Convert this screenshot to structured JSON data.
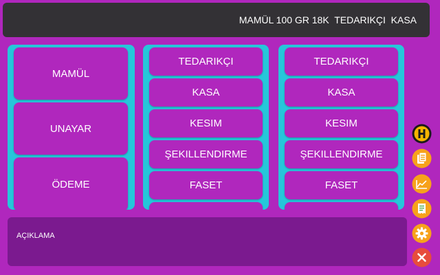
{
  "header": {
    "text": "MAMÜL 100 GR 18K  TEDARIKÇI  KASA"
  },
  "left_panel": {
    "items": [
      {
        "label": "MAMÜL"
      },
      {
        "label": "UNAYAR"
      },
      {
        "label": "ÖDEME"
      }
    ]
  },
  "middle_panel": {
    "items": [
      {
        "label": "TEDARIKÇI"
      },
      {
        "label": "KASA"
      },
      {
        "label": "KESIM"
      },
      {
        "label": "ŞEKILLENDIRME"
      },
      {
        "label": "FASET"
      },
      {
        "label": ""
      }
    ]
  },
  "right_panel": {
    "items": [
      {
        "label": "TEDARIKÇI"
      },
      {
        "label": "KASA"
      },
      {
        "label": "KESIM"
      },
      {
        "label": "ŞEKILLENDIRME"
      },
      {
        "label": "FASET"
      },
      {
        "label": ""
      }
    ]
  },
  "description": {
    "label": "AÇIKLAMA"
  },
  "side_toolbar": {
    "icons": [
      {
        "name": "h-logo-icon",
        "letter": "H",
        "color": "#f5b400"
      },
      {
        "name": "documents-icon",
        "color": "#f7a21b"
      },
      {
        "name": "chart-icon",
        "color": "#f7a21b"
      },
      {
        "name": "receipt-icon",
        "color": "#f7a21b"
      },
      {
        "name": "gear-icon",
        "color": "#f7a21b"
      },
      {
        "name": "close-icon",
        "color": "#e74c3c"
      }
    ]
  },
  "colors": {
    "background": "#b027bd",
    "panel": "#26c6da",
    "button": "#b027bd",
    "header": "#333135",
    "description": "#7b1a8f"
  }
}
